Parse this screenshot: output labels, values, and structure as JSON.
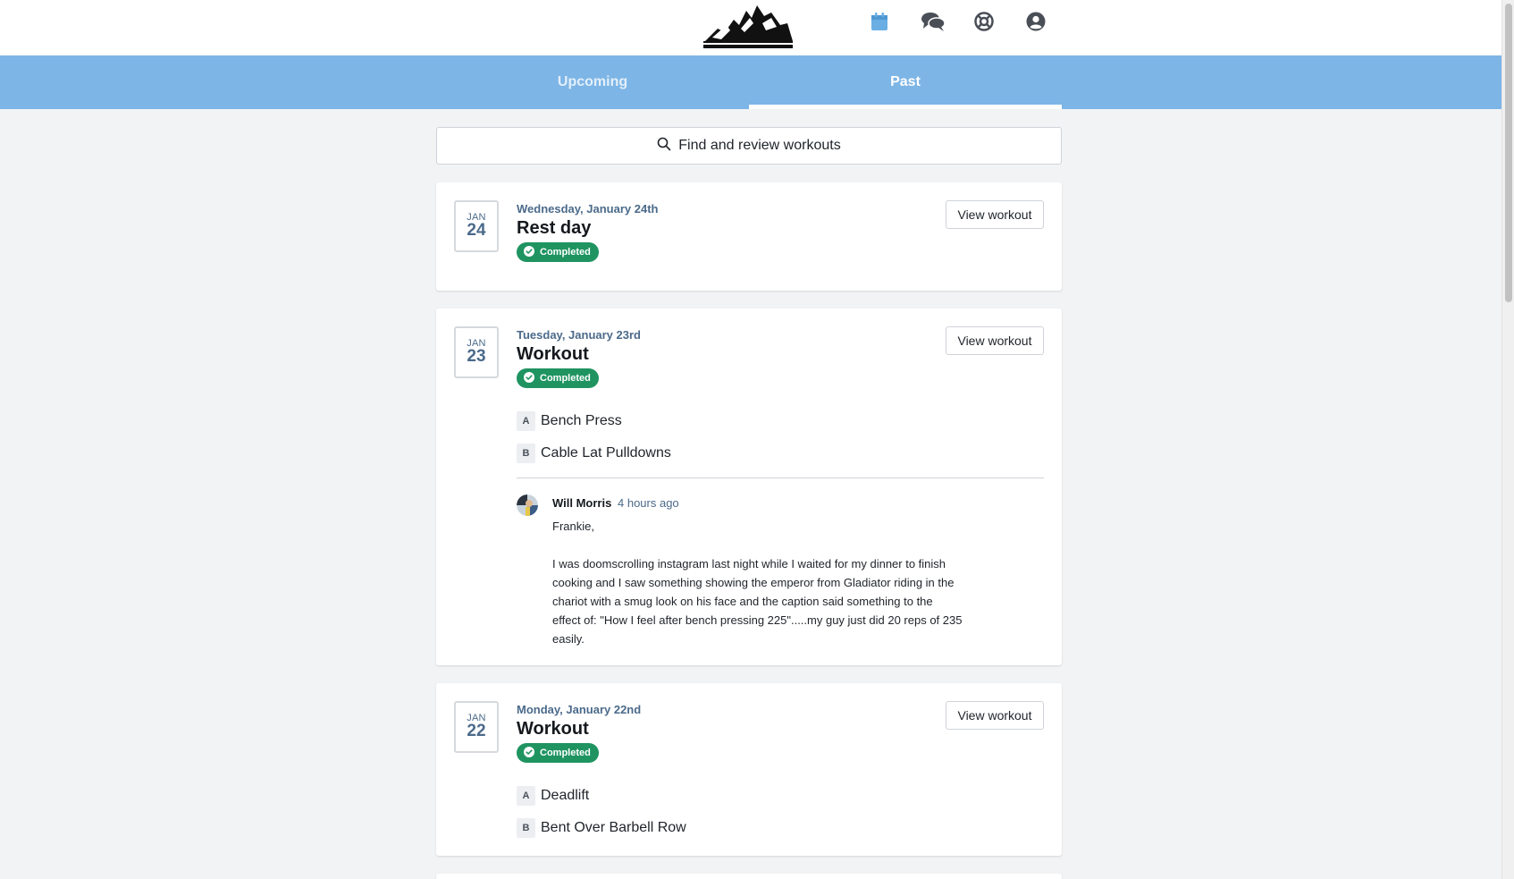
{
  "header": {
    "logo_alt": "Morris Strength & Rehab",
    "icons": [
      "calendar-icon",
      "chat-icon",
      "help-lifebuoy-icon",
      "account-icon"
    ],
    "accent": "#6aaee3"
  },
  "tabs": [
    {
      "label": "Upcoming",
      "active": false
    },
    {
      "label": "Past",
      "active": true
    }
  ],
  "search": {
    "label": "Find and review workouts"
  },
  "colors": {
    "tabbar": "#7db5e6",
    "completed_badge": "#1f9461",
    "date_text": "#4b6a8a"
  },
  "cards": [
    {
      "month": "JAN",
      "day": "24",
      "date_label": "Wednesday, January 24th",
      "title": "Rest day",
      "status": "Completed",
      "action": "View workout",
      "exercises": []
    },
    {
      "month": "JAN",
      "day": "23",
      "date_label": "Tuesday, January 23rd",
      "title": "Workout",
      "status": "Completed",
      "action": "View workout",
      "exercises": [
        {
          "letter": "A",
          "name": "Bench Press"
        },
        {
          "letter": "B",
          "name": "Cable Lat Pulldowns"
        }
      ],
      "comment": {
        "author": "Will Morris",
        "time": "4 hours ago",
        "greeting": "Frankie,",
        "body": "I was doomscrolling instagram last night while I waited for my dinner to finish cooking and I saw something showing the emperor from Gladiator riding in the chariot with a smug look on his face and the caption said something to the effect of: \"How I feel after bench pressing 225\".....my guy just did 20 reps of 235 easily."
      }
    },
    {
      "month": "JAN",
      "day": "22",
      "date_label": "Monday, January 22nd",
      "title": "Workout",
      "status": "Completed",
      "action": "View workout",
      "exercises": [
        {
          "letter": "A",
          "name": "Deadlift"
        },
        {
          "letter": "B",
          "name": "Bent Over Barbell Row"
        }
      ]
    }
  ]
}
